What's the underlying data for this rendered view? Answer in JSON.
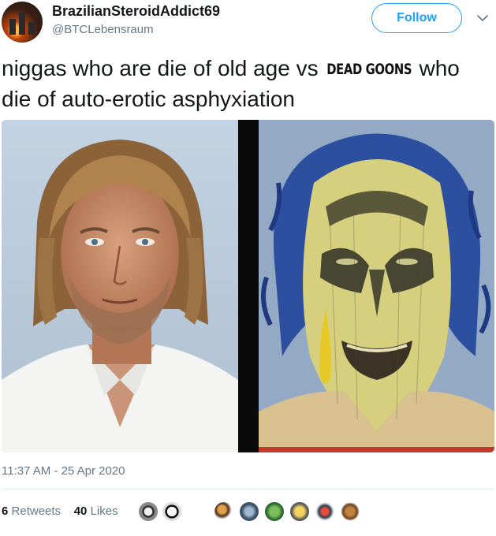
{
  "user": {
    "display_name": "BrazilianSteroidAddict69",
    "handle": "@BTCLebensraum",
    "avatar_icon": "profile-avatar"
  },
  "header": {
    "follow_label": "Follow",
    "menu_icon": "chevron-down-icon"
  },
  "tweet": {
    "text_before": "niggas who are die of old age vs ",
    "inline_image_text": "DEAD GOONS",
    "text_after": " who die of auto-erotic asphyxiation"
  },
  "media": {
    "left_image": "photo-of-man-with-long-hair-white-shirt",
    "right_image": "painting-of-face-with-clown-makeup-blue-hair"
  },
  "meta": {
    "timestamp": "11:37 AM - 25 Apr 2020"
  },
  "stats": {
    "retweets_count": "6",
    "retweets_label": "Retweets",
    "likes_count": "40",
    "likes_label": "Likes"
  },
  "colors": {
    "accent": "#1da1f2",
    "secondary_text": "#657786",
    "separator": "#e1e8ed"
  }
}
